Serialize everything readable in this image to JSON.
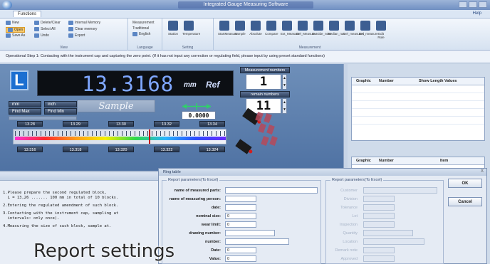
{
  "window": {
    "title": "Integrated Gauge Measuring Software"
  },
  "ribbon": {
    "tab": "Functions",
    "help": "Help",
    "file_items": [
      "New",
      "Open",
      "Save As",
      "Undo"
    ],
    "edit_items": [
      "Delete/Clear",
      "Select All",
      "Internal Memory",
      "Clear memory",
      "Fixed",
      "Export",
      "Delete"
    ],
    "more_items": [
      "Measurement",
      "Setting",
      "Display all",
      "Preference",
      "Reset"
    ],
    "language": {
      "a": "Traditional",
      "b": "English",
      "group": "Language"
    },
    "view_label": "View",
    "setting_label": "Setting",
    "measurement_label": "Measurement",
    "tools": [
      "Station",
      "Temperature",
      "StartMeasure",
      "Sample",
      "Absolute",
      "Compare",
      "Ext_Measure",
      "Del_Measure",
      "Outside_note",
      "Median_run",
      "Del_measures",
      "Del_measure",
      "Edit Role"
    ]
  },
  "status_strip": "Operational Step 1: Contacting with the instrument cap and capturing the zero point. (If it has not input any correction or regulating field, please input by using preset standard functions)",
  "display": {
    "mode_letter": "L",
    "value": "13.3168",
    "unit": "mm",
    "ref": "Ref",
    "unit_mm": "mm",
    "unit_inch": "inch",
    "find_max": "Find Max",
    "find_min": "Find Min",
    "sample": "Sample",
    "secondary_value": "0.0000",
    "scale_top": [
      "13.28",
      "13.29",
      "13.30",
      "13.32",
      "13.34"
    ],
    "scale_bottom": [
      "13.316",
      "13.318",
      "13.320",
      "13.322",
      "13.324"
    ],
    "measurement_numbers_label": "Measurement numbers",
    "measurement_numbers": "1",
    "remain_numbers_label": "remain numbers",
    "remain_numbers": "11"
  },
  "graphic_table_1": {
    "cols": [
      "Graphic",
      "Number",
      "Show Length Values"
    ]
  },
  "graphic_table_2": {
    "cols": [
      "Graphic",
      "Number",
      "Item"
    ]
  },
  "instructions": [
    "1.Please prepare the second regulated block,",
    "  L = 13,26 ....... 100 mm in total of 10 blocks.",
    "2.Entering the regulated amendment of such block.",
    "3.Contacting with the instrument cap, sampling at",
    "  intervals: only once).",
    "4.Measuring the size of such block, sample at."
  ],
  "dialog": {
    "title": "Ring table",
    "close": "X",
    "left_legend": "Report parameters(To Excel)",
    "right_legend": "Report parameters(To Excel)",
    "left_fields": [
      {
        "label": "name of measured parts:",
        "value": ""
      },
      {
        "label": "name of measuring person:",
        "value": ""
      },
      {
        "label": "date:",
        "value": ""
      },
      {
        "label": "nominal size:",
        "value": "0"
      },
      {
        "label": "wear limit:",
        "value": "0"
      },
      {
        "label": "drawing number:",
        "value": ""
      },
      {
        "label": "number:",
        "value": ""
      },
      {
        "label": "Date:",
        "value": "0"
      },
      {
        "label": "Value:",
        "value": "0"
      }
    ],
    "right_fields": [
      "Customer",
      "Division",
      "Tolerance",
      "Lot",
      "Inspection",
      "Quantity",
      "Location",
      "Remark note",
      "Approved"
    ],
    "ok": "OK",
    "cancel": "Cancel"
  },
  "caption": "Report settings",
  "colors": {
    "lcd_text": "#7fa7ff",
    "accent": "#1c6fd1"
  }
}
